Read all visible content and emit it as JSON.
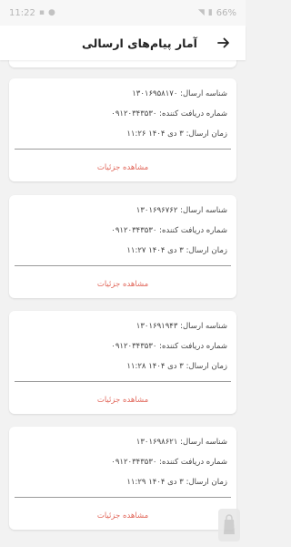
{
  "status_bar": {
    "time": "11:22",
    "battery": "66%"
  },
  "header": {
    "title": "آمار پیام‌های ارسالی",
    "back_icon": "arrow-right-icon"
  },
  "messages": [
    {
      "id_label": "شناسه ارسال: ۱۳۰۱۶۹۵۸۱۷۰",
      "receiver_label": "شماره دریافت کننده: ۰۹۱۲۰۳۴۳۵۳۰",
      "time_label": "زمان ارسال: ۳ دی ۱۴۰۴ ۱۱:۲۶",
      "details_label": "مشاهده جزئیات"
    },
    {
      "id_label": "شناسه ارسال: ۱۳۰۱۶۹۶۷۶۲",
      "receiver_label": "شماره دریافت کننده: ۰۹۱۲۰۳۴۳۵۳۰",
      "time_label": "زمان ارسال: ۳ دی ۱۴۰۴ ۱۱:۲۷",
      "details_label": "مشاهده جزئیات"
    },
    {
      "id_label": "شناسه ارسال: ۱۳۰۱۶۹۱۹۴۳",
      "receiver_label": "شماره دریافت کننده: ۰۹۱۲۰۳۴۳۵۳۰",
      "time_label": "زمان ارسال: ۳ دی ۱۴۰۴ ۱۱:۲۸",
      "details_label": "مشاهده جزئیات"
    },
    {
      "id_label": "شناسه ارسال: ۱۳۰۱۶۹۸۶۲۱",
      "receiver_label": "شماره دریافت کننده: ۰۹۱۲۰۳۴۳۵۳۰",
      "time_label": "زمان ارسال: ۳ دی ۱۴۰۴ ۱۱:۲۹",
      "details_label": "مشاهده جزئیات"
    }
  ],
  "colors": {
    "accent": "#e26a5e",
    "background": "#f2f2f2",
    "card": "#ffffff"
  }
}
